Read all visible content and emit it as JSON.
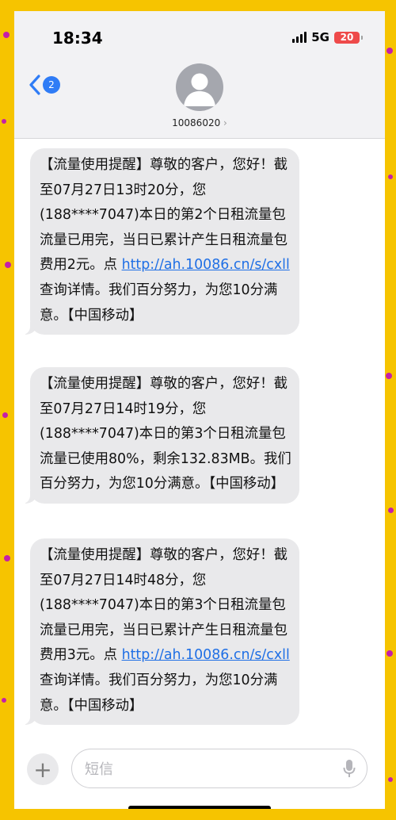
{
  "status_bar": {
    "time": "18:34",
    "network": "5G",
    "battery": "20",
    "battery_color": "#ee4a4a"
  },
  "header": {
    "back_badge": "2",
    "contact": "10086020",
    "contact_arrow": "›"
  },
  "messages": [
    {
      "parts": [
        {
          "text": "【流量使用提醒】尊敬的客户，您好！截至07月27日13时20分，您(188****7047)本日的第2个日租流量包流量已用完，当日已累计产生日租流量包费用2元。点"
        },
        {
          "text": "http://ah.10086.cn/s/cxll",
          "link": true
        },
        {
          "text": "查询详情。我们百分努力，为您10分满意。【中国移动】"
        }
      ]
    },
    {
      "parts": [
        {
          "text": "【流量使用提醒】尊敬的客户，您好！截至07月27日14时19分，您(188****7047)本日的第3个日租流量包流量已使用80%，剩余132.83MB。我们百分努力，为您10分满意。【中国移动】"
        }
      ]
    },
    {
      "parts": [
        {
          "text": "【流量使用提醒】尊敬的客户，您好！截至07月27日14时48分，您(188****7047)本日的第3个日租流量包流量已用完，当日已累计产生日租流量包费用3元。点"
        },
        {
          "text": "http://ah.10086.cn/s/cxll",
          "link": true
        },
        {
          "text": "查询详情。我们百分努力，为您10分满意。【中国移动】"
        }
      ]
    }
  ],
  "composer": {
    "plus": "+",
    "placeholder": "短信"
  },
  "icons": [
    "back-chevron-icon",
    "person-icon",
    "plus-icon",
    "microphone-icon",
    "signal-icon",
    "battery-icon"
  ]
}
